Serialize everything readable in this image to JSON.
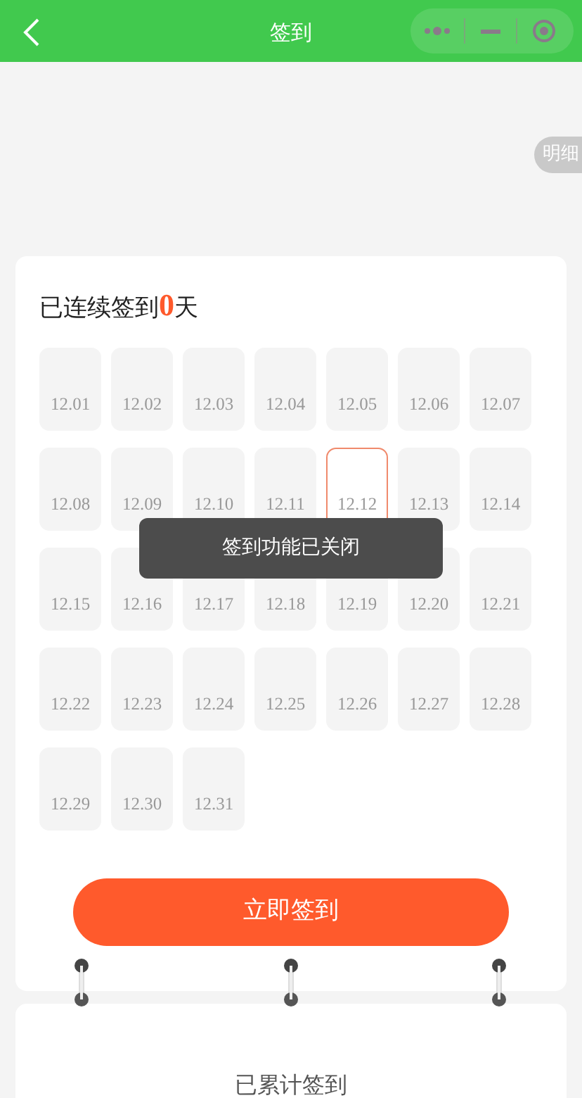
{
  "header": {
    "title": "签到"
  },
  "detail_button": "明细",
  "streak": {
    "prefix": "已连续签到",
    "count": "0",
    "suffix": "天"
  },
  "days": [
    {
      "label": "12.01",
      "today": false
    },
    {
      "label": "12.02",
      "today": false
    },
    {
      "label": "12.03",
      "today": false
    },
    {
      "label": "12.04",
      "today": false
    },
    {
      "label": "12.05",
      "today": false
    },
    {
      "label": "12.06",
      "today": false
    },
    {
      "label": "12.07",
      "today": false
    },
    {
      "label": "12.08",
      "today": false
    },
    {
      "label": "12.09",
      "today": false
    },
    {
      "label": "12.10",
      "today": false
    },
    {
      "label": "12.11",
      "today": false
    },
    {
      "label": "12.12",
      "today": true
    },
    {
      "label": "12.13",
      "today": false
    },
    {
      "label": "12.14",
      "today": false
    },
    {
      "label": "12.15",
      "today": false
    },
    {
      "label": "12.16",
      "today": false
    },
    {
      "label": "12.17",
      "today": false
    },
    {
      "label": "12.18",
      "today": false
    },
    {
      "label": "12.19",
      "today": false
    },
    {
      "label": "12.20",
      "today": false
    },
    {
      "label": "12.21",
      "today": false
    },
    {
      "label": "12.22",
      "today": false
    },
    {
      "label": "12.23",
      "today": false
    },
    {
      "label": "12.24",
      "today": false
    },
    {
      "label": "12.25",
      "today": false
    },
    {
      "label": "12.26",
      "today": false
    },
    {
      "label": "12.27",
      "today": false
    },
    {
      "label": "12.28",
      "today": false
    },
    {
      "label": "12.29",
      "today": false
    },
    {
      "label": "12.30",
      "today": false
    },
    {
      "label": "12.31",
      "today": false
    }
  ],
  "toast": "签到功能已关闭",
  "signin_button": "立即签到",
  "total_label": "已累计签到"
}
